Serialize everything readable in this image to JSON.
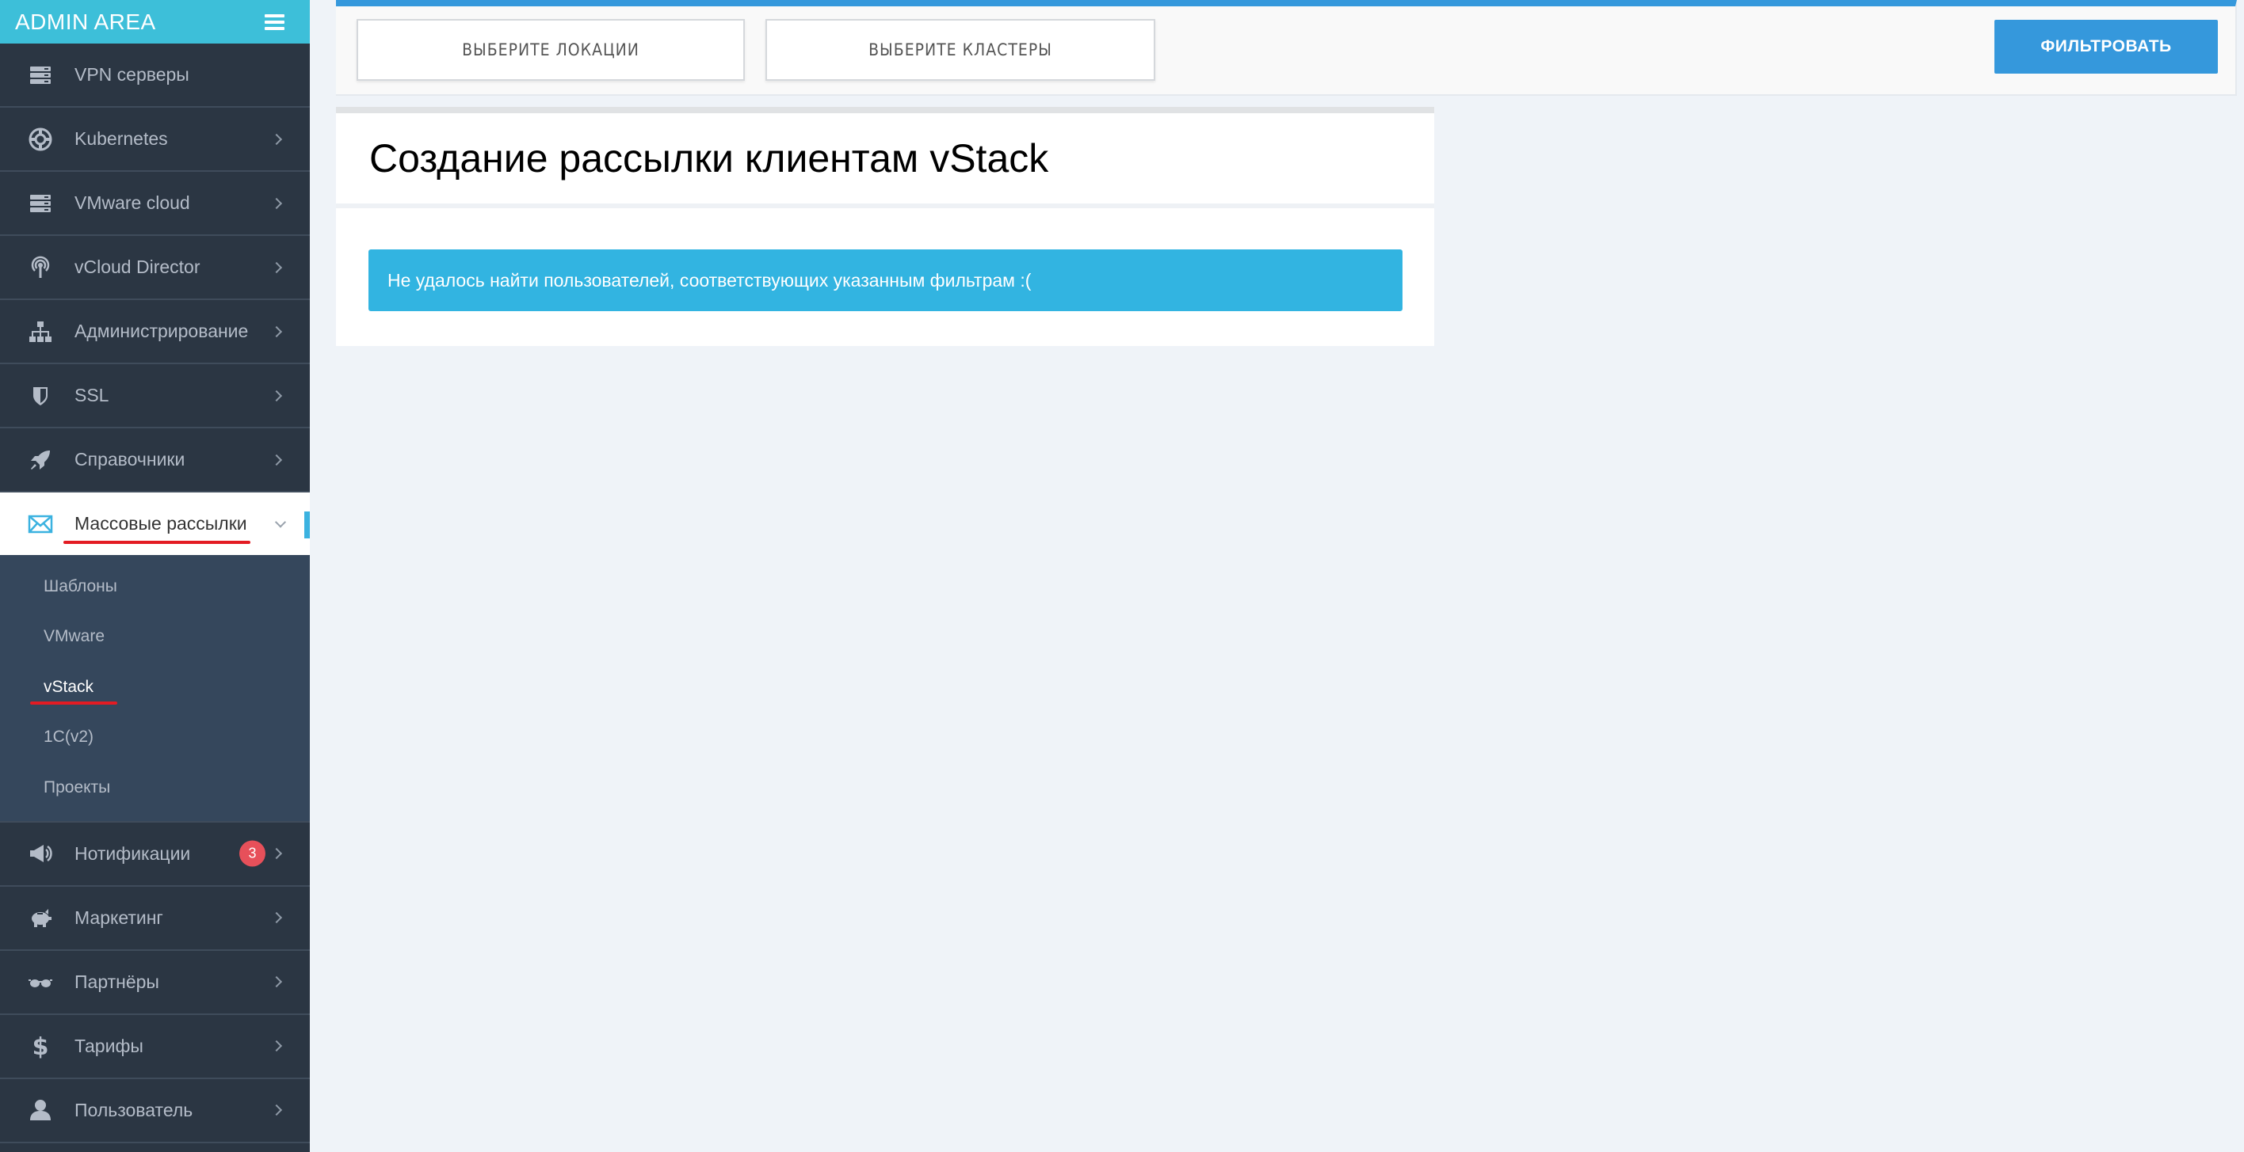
{
  "brand": {
    "title": "ADMIN AREA"
  },
  "sidebar": {
    "items": [
      {
        "label": "VPN серверы",
        "icon": "server-icon",
        "has_chevron": false
      },
      {
        "label": "Kubernetes",
        "icon": "lifebuoy-icon",
        "has_chevron": true
      },
      {
        "label": "VMware cloud",
        "icon": "server-icon",
        "has_chevron": true
      },
      {
        "label": "vCloud Director",
        "icon": "broadcast-icon",
        "has_chevron": true
      },
      {
        "label": "Администрирование",
        "icon": "sitemap-icon",
        "has_chevron": true
      },
      {
        "label": "SSL",
        "icon": "shield-icon",
        "has_chevron": true
      },
      {
        "label": "Справочники",
        "icon": "rocket-icon",
        "has_chevron": true
      },
      {
        "label": "Массовые рассылки",
        "icon": "envelope-icon",
        "active": true,
        "expanded": true
      },
      {
        "label": "Нотификации",
        "icon": "megaphone-icon",
        "has_chevron": true,
        "badge": "3"
      },
      {
        "label": "Маркетинг",
        "icon": "piggy-bank-icon",
        "has_chevron": true
      },
      {
        "label": "Партнёры",
        "icon": "eyeglasses-icon",
        "has_chevron": true
      },
      {
        "label": "Тарифы",
        "icon": "dollar-icon",
        "has_chevron": true
      },
      {
        "label": "Пользователь",
        "icon": "user-icon",
        "has_chevron": true
      }
    ],
    "submenu": [
      {
        "label": "Шаблоны"
      },
      {
        "label": "VMware"
      },
      {
        "label": "vStack",
        "active": true
      },
      {
        "label": "1C(v2)"
      },
      {
        "label": "Проекты"
      }
    ]
  },
  "filters": {
    "locations_label": "ВЫБЕРИТЕ ЛОКАЦИИ",
    "clusters_label": "ВЫБЕРИТЕ КЛАСТЕРЫ",
    "filter_button": "ФИЛЬТРОВАТЬ"
  },
  "main": {
    "title": "Создание рассылки клиентам vStack",
    "alert": "Не удалось найти пользователей, соответствующих указанным фильтрам :("
  },
  "colors": {
    "sidebar_bg": "#2b3643",
    "brand_bg": "#3dbfd9",
    "accent": "#3598dc",
    "alert_bg": "#32b4e1",
    "badge": "#e7505a",
    "highlight_underline": "#e31b23"
  }
}
